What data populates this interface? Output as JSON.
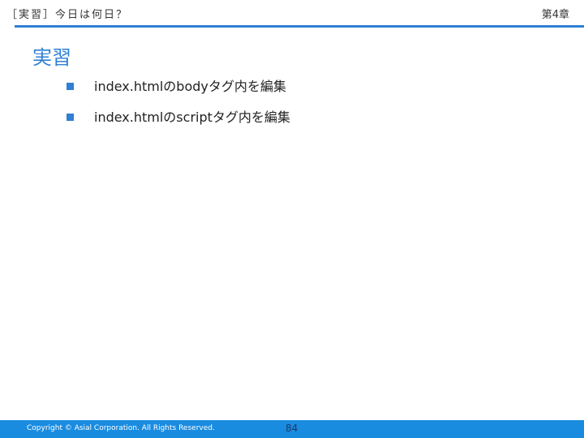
{
  "header": {
    "title": "［実習］今日は何日？",
    "chapter": "第4章"
  },
  "slide": {
    "title": "実習",
    "bullets": [
      {
        "text": "index.htmlのbodyタグ内を編集"
      },
      {
        "text": "index.htmlのscriptタグ内を編集"
      }
    ]
  },
  "footer": {
    "copyright": "Copyright © Asial Corporation. All Rights Reserved.",
    "page_number": "84"
  },
  "colors": {
    "accent": "#2f7fd4",
    "footer_bar": "#1a8ce0"
  }
}
